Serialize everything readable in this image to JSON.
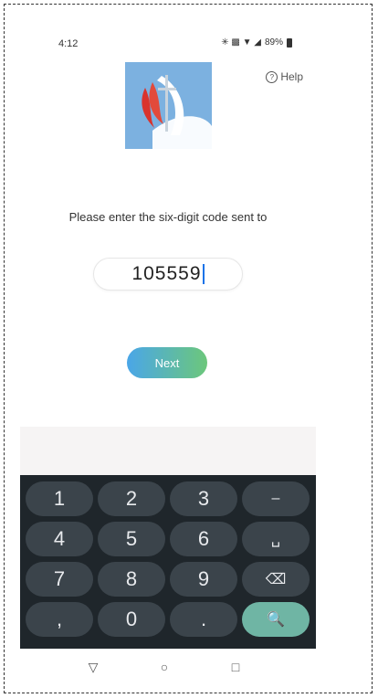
{
  "status_bar": {
    "time": "4:12",
    "icons": "✳ ▩ ▼ ◢",
    "battery": "89%"
  },
  "header": {
    "logo_name": "church-logo",
    "help_label": "Help",
    "help_icon": "?"
  },
  "main": {
    "instruction": "Please enter the six-digit code sent to",
    "code_value": "105559",
    "next_label": "Next"
  },
  "keyboard": {
    "keys": [
      [
        "1",
        "2",
        "3",
        "–"
      ],
      [
        "4",
        "5",
        "6",
        "␣"
      ],
      [
        "7",
        "8",
        "9",
        "⌫"
      ],
      [
        ",",
        "0",
        ".",
        "🔍"
      ]
    ]
  },
  "nav": {
    "back": "▽",
    "home": "○",
    "recents": "□"
  },
  "colors": {
    "keyboard_bg": "#1f262b",
    "key_bg": "#3b444b",
    "search_key": "#6fb5a4",
    "next_gradient_start": "#4aa6e8",
    "next_gradient_end": "#6cc77b"
  }
}
